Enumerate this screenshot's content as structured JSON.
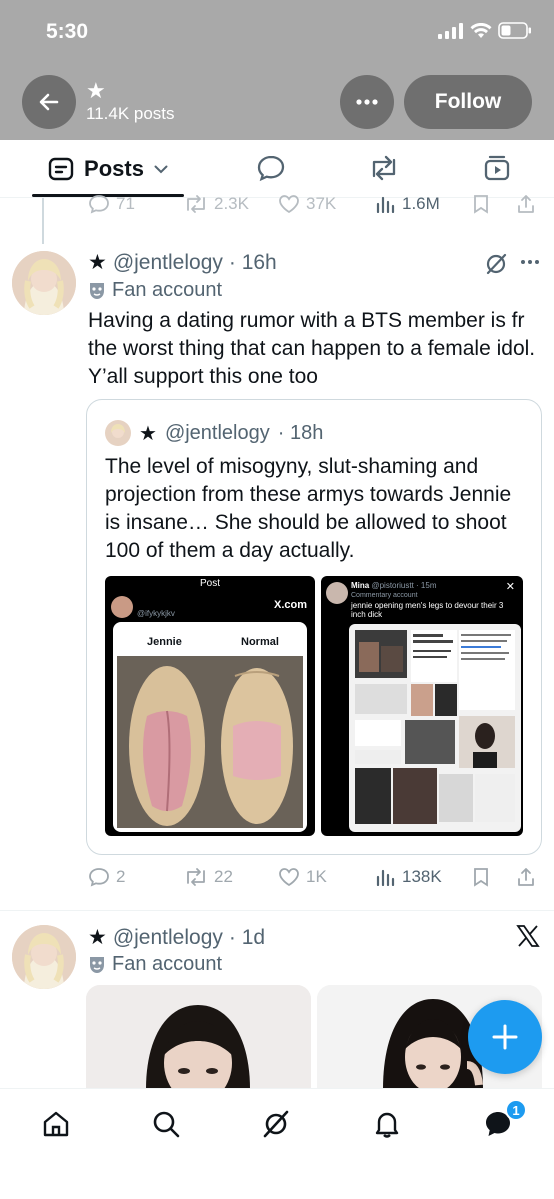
{
  "status_bar": {
    "time": "5:30"
  },
  "header": {
    "star": "★",
    "post_count": "11.4K posts",
    "follow_label": "Follow"
  },
  "tabs": {
    "posts_label": "Posts"
  },
  "prev_post": {
    "replies": "71",
    "reposts": "2.3K",
    "likes": "37K",
    "views": "1.6M"
  },
  "post1": {
    "star": "★",
    "handle": "@jentlelogy",
    "time": "· 16h",
    "label": "Fan account",
    "text": "Having a dating rumor with a BTS member is fr the worst thing that can happen to a female idol. Y’all support this one too",
    "quote": {
      "star": "★",
      "handle": "@jentlelogy",
      "time": "· 18h",
      "text": "The level of misogyny, slut-shaming and projection from these armys towards Jennie is insane… She should be allowed to shoot 100 of them a day actually.",
      "left_image": {
        "header": "Post",
        "user": "@ifykykjkv",
        "brand": "X.com",
        "label_left": "Jennie",
        "label_right": "Normal"
      },
      "right_image": {
        "name": "Mina",
        "handle": "@pistoriustt · 15m",
        "label": "Commentary account",
        "caption": "jennie opening men's legs to devour their 3 inch dick"
      }
    },
    "stats": {
      "replies": "2",
      "reposts": "22",
      "likes": "1K",
      "views": "138K"
    }
  },
  "post2": {
    "star": "★",
    "handle": "@jentlelogy",
    "time": "· 1d",
    "label": "Fan account"
  },
  "nav": {
    "badge": "1"
  },
  "colors": {
    "accent": "#1d9bf0",
    "header_bg": "#a9a9a9"
  }
}
